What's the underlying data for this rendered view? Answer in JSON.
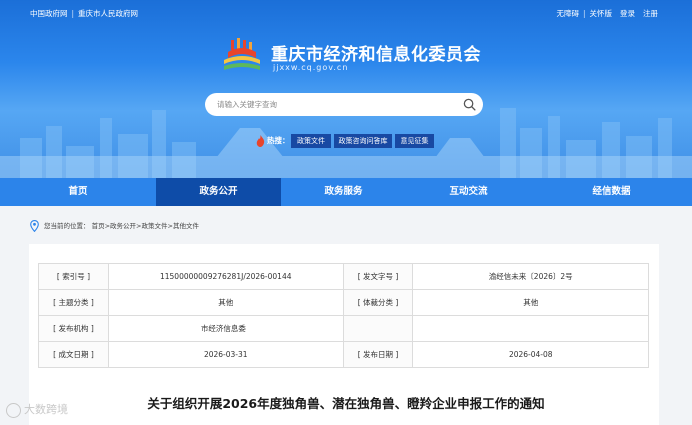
{
  "topbar": {
    "left_links": [
      "中国政府网",
      "重庆市人民政府网"
    ],
    "right_links": [
      "无障碍",
      "关怀版",
      "登录",
      "注册"
    ]
  },
  "brand": {
    "title": "重庆市经济和信息化委员会",
    "domain": "jjxxw.cq.gov.cn"
  },
  "search": {
    "placeholder": "请输入关键字查询"
  },
  "hot": {
    "label": "热搜：",
    "tags": [
      "政策文件",
      "政策咨询问答库",
      "意见征集"
    ]
  },
  "nav": {
    "items": [
      "首页",
      "政务公开",
      "政务服务",
      "互动交流",
      "经信数据"
    ],
    "active": "政务公开"
  },
  "breadcrumb": {
    "prefix": "您当前的位置：",
    "items": [
      "首页",
      "政务公开",
      "政策文件",
      "其他文件"
    ],
    "separator": ">"
  },
  "info_table": {
    "rows": [
      [
        {
          "k": "[ 索引号 ]",
          "v": "11500000009276281J/2026-00144"
        },
        {
          "k": "[ 发文字号 ]",
          "v": "渝经信未来〔2026〕2号"
        }
      ],
      [
        {
          "k": "[ 主题分类 ]",
          "v": "其他"
        },
        {
          "k": "[ 体裁分类 ]",
          "v": "其他"
        }
      ],
      [
        {
          "k": "[ 发布机构 ]",
          "v": "市经济信息委"
        },
        {
          "k": "",
          "v": ""
        }
      ],
      [
        {
          "k": "[ 成文日期 ]",
          "v": "2026-03-31"
        },
        {
          "k": "[ 发布日期 ]",
          "v": "2026-04-08"
        }
      ]
    ]
  },
  "document": {
    "title": "关于组织开展2026年度独角兽、潜在独角兽、瞪羚企业申报工作的通知"
  },
  "watermark": {
    "text": "大数跨境"
  },
  "colors": {
    "header_blue": "#2b86ec",
    "nav_blue": "#2c84ea",
    "nav_active": "#0e4ca8",
    "tag_bg": "#1849a3",
    "flame_red": "#e8452c"
  }
}
